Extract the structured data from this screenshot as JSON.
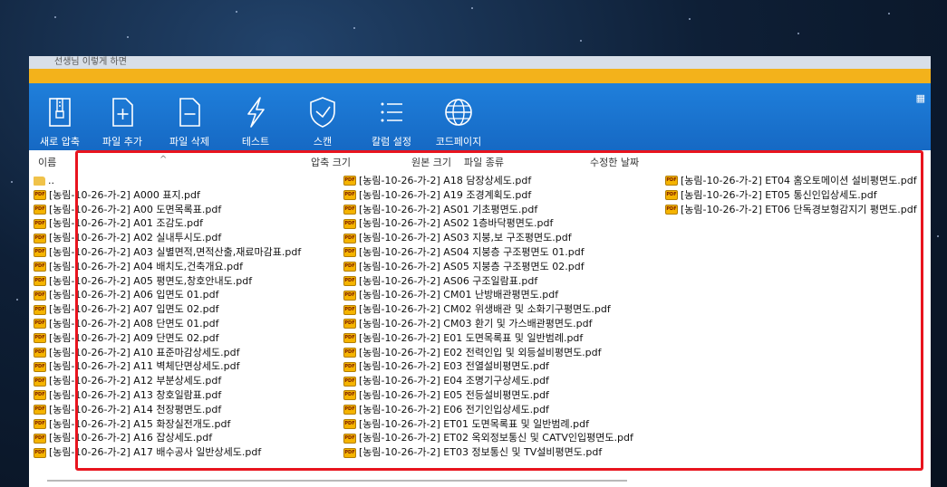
{
  "window": {
    "title": "선생님 이렇게 하면"
  },
  "toolbar": {
    "items": [
      {
        "label": "새로 압축",
        "icon": "archive-zip-icon"
      },
      {
        "label": "파일 추가",
        "icon": "file-add-icon"
      },
      {
        "label": "파일 삭제",
        "icon": "file-remove-icon"
      },
      {
        "label": "테스트",
        "icon": "lightning-icon"
      },
      {
        "label": "스캔",
        "icon": "shield-check-icon"
      },
      {
        "label": "칼럼 설정",
        "icon": "column-settings-icon"
      },
      {
        "label": "코드페이지",
        "icon": "globe-icon"
      }
    ],
    "view_icon": "grid-view-icon"
  },
  "columns": {
    "name": "이름",
    "compressed_size": "압축 크기",
    "original_size": "원본 크기",
    "file_type": "파일 종류",
    "modified_date": "수정한 날짜"
  },
  "files": {
    "parent": "..",
    "column1": [
      "[농림-10-26-가-2] A000 표지.pdf",
      "[농림-10-26-가-2] A00 도면목록표.pdf",
      "[농림-10-26-가-2] A01 조감도.pdf",
      "[농림-10-26-가-2] A02 실내투시도.pdf",
      "[농림-10-26-가-2] A03 실별면적,면적산출,재료마감표.pdf",
      "[농림-10-26-가-2] A04 배치도,건축개요.pdf",
      "[농림-10-26-가-2] A05 평면도,창호안내도.pdf",
      "[농림-10-26-가-2] A06 입면도 01.pdf",
      "[농림-10-26-가-2] A07 입면도 02.pdf",
      "[농림-10-26-가-2] A08 단면도 01.pdf",
      "[농림-10-26-가-2] A09 단면도 02.pdf",
      "[농림-10-26-가-2] A10 표준마감상세도.pdf",
      "[농림-10-26-가-2] A11 벽체단면상세도.pdf",
      "[농림-10-26-가-2] A12 부분상세도.pdf",
      "[농림-10-26-가-2] A13 창호일람표.pdf",
      "[농림-10-26-가-2] A14 천장평면도.pdf",
      "[농림-10-26-가-2] A15 화장실전개도.pdf",
      "[농림-10-26-가-2] A16 잡상세도.pdf",
      "[농림-10-26-가-2] A17 배수공사 일반상세도.pdf"
    ],
    "column2": [
      "[농림-10-26-가-2] A18 담장상세도.pdf",
      "[농림-10-26-가-2] A19 조경계획도.pdf",
      "[농림-10-26-가-2] AS01 기초평면도.pdf",
      "[농림-10-26-가-2] AS02 1층바닥평면도.pdf",
      "[농림-10-26-가-2] AS03 지붕,보 구조평면도.pdf",
      "[농림-10-26-가-2] AS04 지붕층 구조평면도 01.pdf",
      "[농림-10-26-가-2] AS05 지붕층 구조평면도 02.pdf",
      "[농림-10-26-가-2] AS06 구조일람표.pdf",
      "[농림-10-26-가-2] CM01 난방배관평면도.pdf",
      "[농림-10-26-가-2] CM02 위생배관 및 소화기구평면도.pdf",
      "[농림-10-26-가-2] CM03 환기 및 가스배관평면도.pdf",
      "[농림-10-26-가-2] E01 도면목록표 및 일반범례.pdf",
      "[농림-10-26-가-2] E02 전력인입 및 외등설비평면도.pdf",
      "[농림-10-26-가-2] E03 전열설비평면도.pdf",
      "[농림-10-26-가-2] E04 조명기구상세도.pdf",
      "[농림-10-26-가-2] E05 전등설비평면도.pdf",
      "[농림-10-26-가-2] E06 전기인입상세도.pdf",
      "[농림-10-26-가-2] ET01 도면목록표 및 일반범례.pdf",
      "[농림-10-26-가-2] ET02 옥외정보통신 및 CATV인입평면도.pdf",
      "[농림-10-26-가-2] ET03 정보통신 및 TV설비평면도.pdf"
    ],
    "column3": [
      "[농림-10-26-가-2] ET04 홈오토메이션 설비평면도.pdf",
      "[농림-10-26-가-2] ET05 통신인입상세도.pdf",
      "[농림-10-26-가-2] ET06 단독경보형감지기 평면도.pdf"
    ]
  }
}
